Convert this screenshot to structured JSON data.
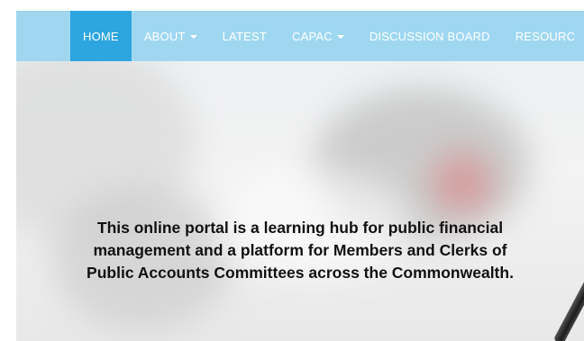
{
  "nav": {
    "items": [
      {
        "label": "HOME",
        "active": true,
        "dropdown": false
      },
      {
        "label": "ABOUT",
        "active": false,
        "dropdown": true
      },
      {
        "label": "LATEST",
        "active": false,
        "dropdown": false
      },
      {
        "label": "CAPAC",
        "active": false,
        "dropdown": true
      },
      {
        "label": "DISCUSSION BOARD",
        "active": false,
        "dropdown": false
      },
      {
        "label": "RESOURC",
        "active": false,
        "dropdown": false
      }
    ]
  },
  "hero": {
    "line1": "This online portal is a learning hub for public financial",
    "line2": "management and a platform for Members and Clerks of",
    "line3": "Public Accounts Committees across the Commonwealth."
  },
  "colors": {
    "navbar": "#9fd7f1",
    "active": "#2da6df",
    "nav_text": "#ffffff"
  }
}
